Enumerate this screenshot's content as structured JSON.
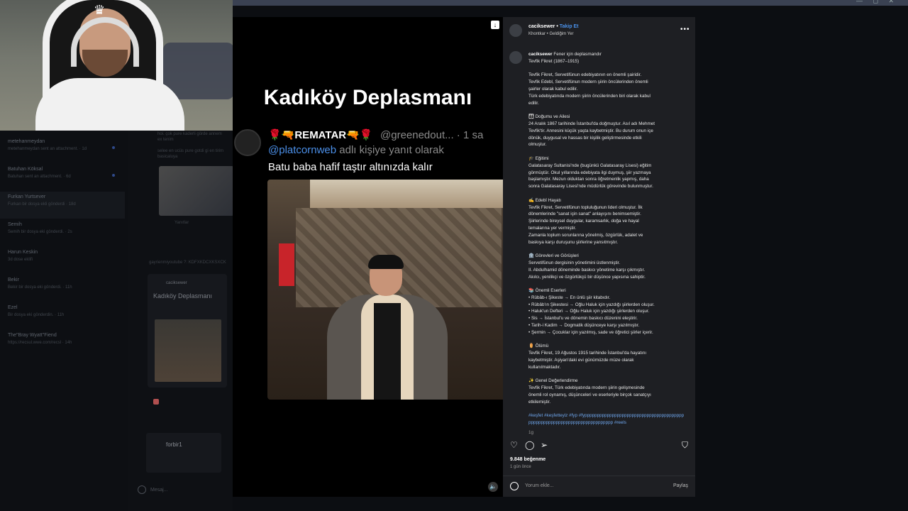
{
  "reel": {
    "title": "Kadıköy Deplasmanı",
    "tweet_name": "🌹🔫REMATAR🔫🌹",
    "tweet_handle": "@greenedout... · 1 sa",
    "tweet_reply_handle": "@platcornweb",
    "tweet_reply_suffix": " adlı kişiye yanıt olarak",
    "tweet_text": "Batu baba hafif taştır altınızda kalır"
  },
  "post": {
    "username": "caciksewer",
    "follow": "Takip Et",
    "subtitle": "Khontkar • Geldiğim Yer",
    "caption_title": "Fener için deplasmandır",
    "caption_paragraphs": [
      [
        "Tevfik Fikret (1867–1915)"
      ],
      [
        "Tevfik Fikret, Servetifünun edebiyatının en önemli şairidir.",
        "Tevfik Edebl, Servetifünun modern şiirin öncülerinden önemli",
        "şairler olarak kabul edilir.",
        "Türk edebiyatında modern şiirin öncülerinden biri olarak kabul",
        "edilir."
      ],
      [
        "👪 Doğumu ve Ailesi",
        "24 Aralık 1867 tarihinde İstanbul'da doğmuştur. Asıl adı Mehmet",
        "Tevfik'tir. Annesini küçük yaşta kaybetmiştir. Bu durum onun içe",
        "dönük, duygusal ve hassas bir kişilik geliştirmesinde etkili",
        "olmuştur."
      ],
      [
        "🎓 Eğitimi",
        "Galatasaray Sultanisi'nde (bugünkü Galatasaray Lisesi) eğitim",
        "görmüştür. Okul yıllarında edebiyata ilgi duymuş, şiir yazmaya",
        "başlamıştır. Mezun olduktan sonra öğretmenlik yapmış, daha",
        "sonra Galatasaray Lisesi'nde müdürlük görevinde bulunmuştur."
      ],
      [
        "✍️ Edebî Hayatı",
        "Tevfik Fikret, Servetifünun topluluğunun lideri olmuştur. İlk",
        "dönemlerinde \"sanat için sanat\" anlayışını benimsemiştir.",
        "Şiirlerinde bireysel duygular, karamsarlık, doğa ve hayal",
        "temalarına yer vermiştir.",
        "Zamanla toplum sorunlarına yönelmiş, özgürlük, adalet ve",
        "baskıya karşı duruşunu şiirlerine yansıtmıştır."
      ],
      [
        "🏛️ Görevleri ve Görüşleri",
        "Servetifünun dergisinin yönetimini üstlenmiştir.",
        "II. Abdulhamid döneminde baskıcı yönetime karşı çıkmıştır.",
        "Akılcı, yenilikçi ve özgürlükçü bir düşünce yapısına sahiptir."
      ],
      [
        "📚 Önemli Eserleri",
        "• Rübâb-ı Şikeste → En ünlü şiir kitabıdır.",
        "• Rübâb'ın Şikestesi → Oğlu Haluk için yazdığı şiirlerden oluşur.",
        "• Haluk'un Defteri → Oğlu Haluk için yazdığı şiirlerden oluşur.",
        "• Sis → İstanbul'u ve dönemin baskıcı düzenini eleştirir.",
        "• Tarih-i Kadim → Dogmatik düşünceye karşı yazılmıştır.",
        "• Şermin → Çocuklar için yazılmış, sade ve öğretici şiirler içerir."
      ],
      [
        "⚱️ Ölümü",
        "Tevfik Fikret, 19 Ağustos 1915 tarihinde İstanbul'da hayatını",
        "kaybetmiştir. Aşiyan'daki evi günümüzde müze olarak",
        "kullanılmaktadır."
      ],
      [
        "✨ Genel Değerlendirme",
        "Tevfik Fikret, Türk edebiyatında modern şiirin gelişmesinde",
        "önemli rol oynamış, düşünceleri ve eserleriyle birçok sanatçıyı",
        "etkilemiştir."
      ]
    ],
    "tags": "#keşfet #keşfetteyiz #fyp #fypppppppppppppppppppppppppppppppppppppppppppppppppppppppppppppppppppppppppp #reels",
    "caption_age": "1g",
    "likes": "9.848 beğenme",
    "ago": "1 gün önce",
    "comment_placeholder": "Yorum ekle...",
    "share": "Paylaş"
  },
  "dms": [
    {
      "name": "metehanmeydan",
      "sub": "metehanmeydan sent an attachment. · 1d",
      "unread": true
    },
    {
      "name": "Batuhan Köksal",
      "sub": "Batuhan sent an attachment. · 6d",
      "unread": true
    },
    {
      "name": "Furkan Yurtsever",
      "sub": "Furkan bir dosya ekli gönderdi · 18d",
      "unread": false
    },
    {
      "name": "Semih",
      "sub": "Semih bir dosya eki gönderdi. · 2s",
      "unread": false
    },
    {
      "name": "Harun Keskin",
      "sub": "3d dose eklifi",
      "unread": false
    },
    {
      "name": "Bekir",
      "sub": "Bekir bir dosya eki gönderdi. · 11h",
      "unread": false
    },
    {
      "name": "Ezel",
      "sub": "Bir dosya eki gönderdin. · 11h",
      "unread": false
    },
    {
      "name": "The\"Bray Wyatt\"Fiend",
      "sub": "https://recsul.wwe.com/recsl · 14h",
      "unread": false
    }
  ],
  "chat": {
    "line1": "hoi. çok pure kaderli görde annem",
    "line2": "ex tenim",
    "line3": "selee en ucüs pure gotdi gi en tirim",
    "line4": "basicaluya",
    "replies": "Yanıtlar",
    "shared_user": "gayrienmiyoutube ?: KDFXKDCXKSXCK",
    "card_user": "caciksewer",
    "card_title": "Kadıköy Deplasmanı",
    "bottom_label": "forbir1",
    "message_placeholder": "Mesaj..."
  },
  "colors": {
    "accent": "#4a90e8",
    "panel": "#1e1f23",
    "background": "#000000"
  }
}
